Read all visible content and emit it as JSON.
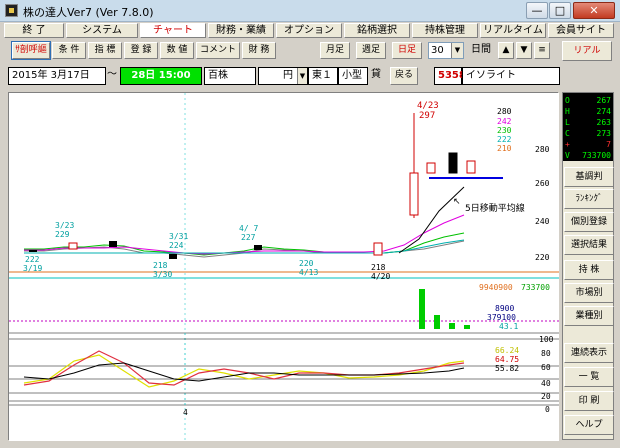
{
  "window": {
    "title": "株の達人Ver7 (Ver 7.8.0)",
    "min": "—",
    "max": "□",
    "close": "✕"
  },
  "menu": [
    {
      "label": "終 了"
    },
    {
      "label": "システム"
    },
    {
      "label": "チャート",
      "active": true
    },
    {
      "label": "財務・業績"
    },
    {
      "label": "オプション"
    },
    {
      "label": "銘柄選択"
    },
    {
      "label": "持株管理"
    },
    {
      "label": "リアルタイム"
    },
    {
      "label": "会員サイト"
    }
  ],
  "toolbar": {
    "buttons": [
      "ｻ剖呼謳",
      "条 件",
      "指 標",
      "登 録",
      "数 値",
      "コメント",
      "財 務"
    ],
    "period_buttons": [
      "月足",
      "週足",
      "日足"
    ],
    "count_value": "30",
    "period_select": "日間",
    "nav_up": "▲",
    "nav_down": "▼",
    "menu_icon": "≡",
    "real_label": "リアル"
  },
  "info": {
    "date": "2015年 3月17日",
    "tilde": "～",
    "end_date": "28日 15:00",
    "unit": "百株",
    "currency": "円",
    "market": "東１",
    "category": "小型",
    "lending": "貸",
    "back_label": "戻る",
    "code": "5358",
    "name": "イソライト"
  },
  "quote": [
    {
      "k": "O",
      "v": "267"
    },
    {
      "k": "H",
      "v": "274"
    },
    {
      "k": "L",
      "v": "263"
    },
    {
      "k": "C",
      "v": "273"
    },
    {
      "k": "+",
      "v": "7"
    },
    {
      "k": "V",
      "v": "733700"
    }
  ],
  "side_buttons": [
    "基調判",
    "ﾗﾝｷﾝｸﾞ",
    "個別登録",
    "選択結果",
    "持 株",
    "市場別",
    "業種別",
    "連続表示",
    "一 覧",
    "印 刷",
    "ヘルプ"
  ],
  "colors": {
    "accent_red": "#d00000",
    "green": "#00c000",
    "quote_bg": "#000000",
    "quote_fg": "#00ff00"
  },
  "chart_data": {
    "type": "line",
    "price_axis": [
      "280",
      "260",
      "240",
      "220"
    ],
    "legend_values": [
      "280",
      "242",
      "230",
      "222",
      "210"
    ],
    "annotations": [
      {
        "text": "4/23"
      },
      {
        "text": "297"
      },
      {
        "text": "3/23"
      },
      {
        "text": "229"
      },
      {
        "text": "3/31"
      },
      {
        "text": "224"
      },
      {
        "text": "4/ 7"
      },
      {
        "text": "227"
      },
      {
        "text": "222"
      },
      {
        "text": "3/19"
      },
      {
        "text": "218"
      },
      {
        "text": "3/30"
      },
      {
        "text": "220"
      },
      {
        "text": "4/13"
      },
      {
        "text": "218"
      },
      {
        "text": "4/20"
      }
    ],
    "ma_label": "5日移動平均線",
    "volume_values": [
      "9940900",
      "733700"
    ],
    "indicator_values": [
      "8900",
      "379100",
      "43.1"
    ],
    "osc_axis": [
      "100",
      "80",
      "60",
      "40",
      "20",
      "0"
    ],
    "osc_values": [
      "66.24",
      "64.75",
      "55.82"
    ],
    "x_label": "4"
  }
}
